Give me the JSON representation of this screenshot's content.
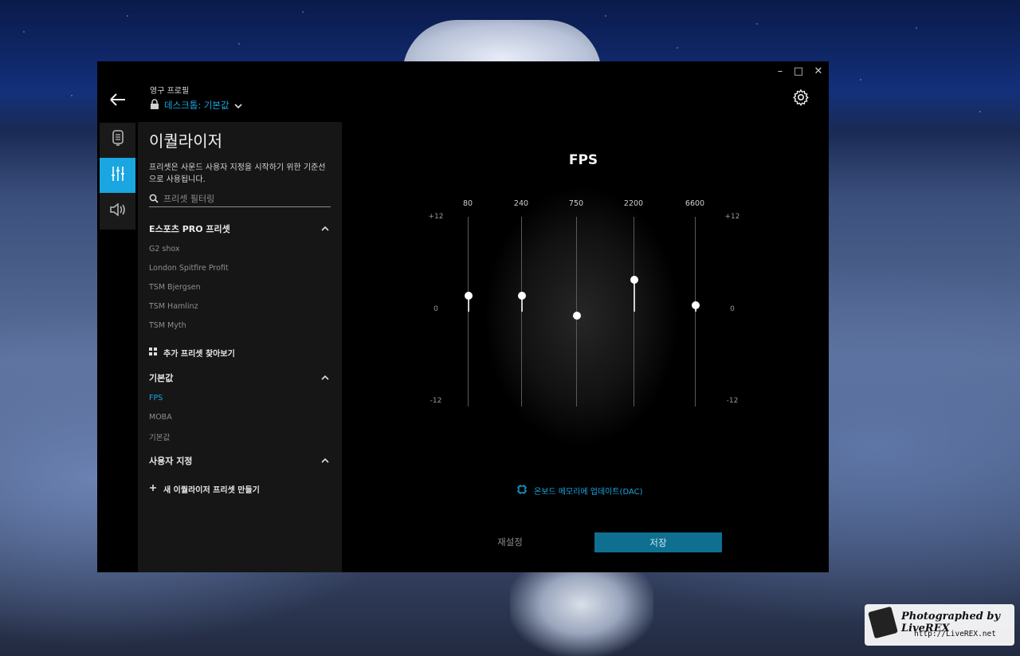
{
  "window": {
    "minimize": "–",
    "maximize": "□",
    "close": "✕"
  },
  "header": {
    "profile_label": "영구 프로필",
    "profile_name": "데스크톱: 기본값"
  },
  "panel": {
    "title": "이퀄라이저",
    "description": "프리셋은 사운드 사용자 지정을 시작하기 위한 기준선으로 사용됩니다.",
    "filter_placeholder": "프리셋 필터링",
    "esports_header": "E스포츠 PRO 프리셋",
    "esports_items": [
      "G2 shox",
      "London Spitfire Profit",
      "TSM Bjergsen",
      "TSM Hamlinz",
      "TSM Myth"
    ],
    "browse_more": "추가 프리셋 찾아보기",
    "defaults_header": "기본값",
    "default_items": [
      "FPS",
      "MOBA",
      "기본값"
    ],
    "custom_header": "사용자 지정",
    "create_new": "새 이퀄라이저 프리셋 만들기"
  },
  "main": {
    "preset_title": "FPS",
    "scale_top": "+12",
    "scale_mid": "0",
    "scale_bottom": "-12",
    "dac_link": "온보드 메모리에 업데이트(DAC)",
    "reset_label": "재설정",
    "save_label": "저장"
  },
  "eq": {
    "bands": [
      "80",
      "240",
      "750",
      "2200",
      "6600"
    ],
    "gains_db": [
      2,
      2,
      -0.5,
      4,
      0.8
    ],
    "range": [
      -12,
      12
    ]
  },
  "watermark": {
    "line1": "Photographed by LiveREX",
    "line2": "http://LiveREX.net"
  },
  "colors": {
    "accent": "#1aa6e0",
    "save_button": "#0e6f91",
    "panel_bg": "#161616",
    "app_bg": "#000000"
  }
}
